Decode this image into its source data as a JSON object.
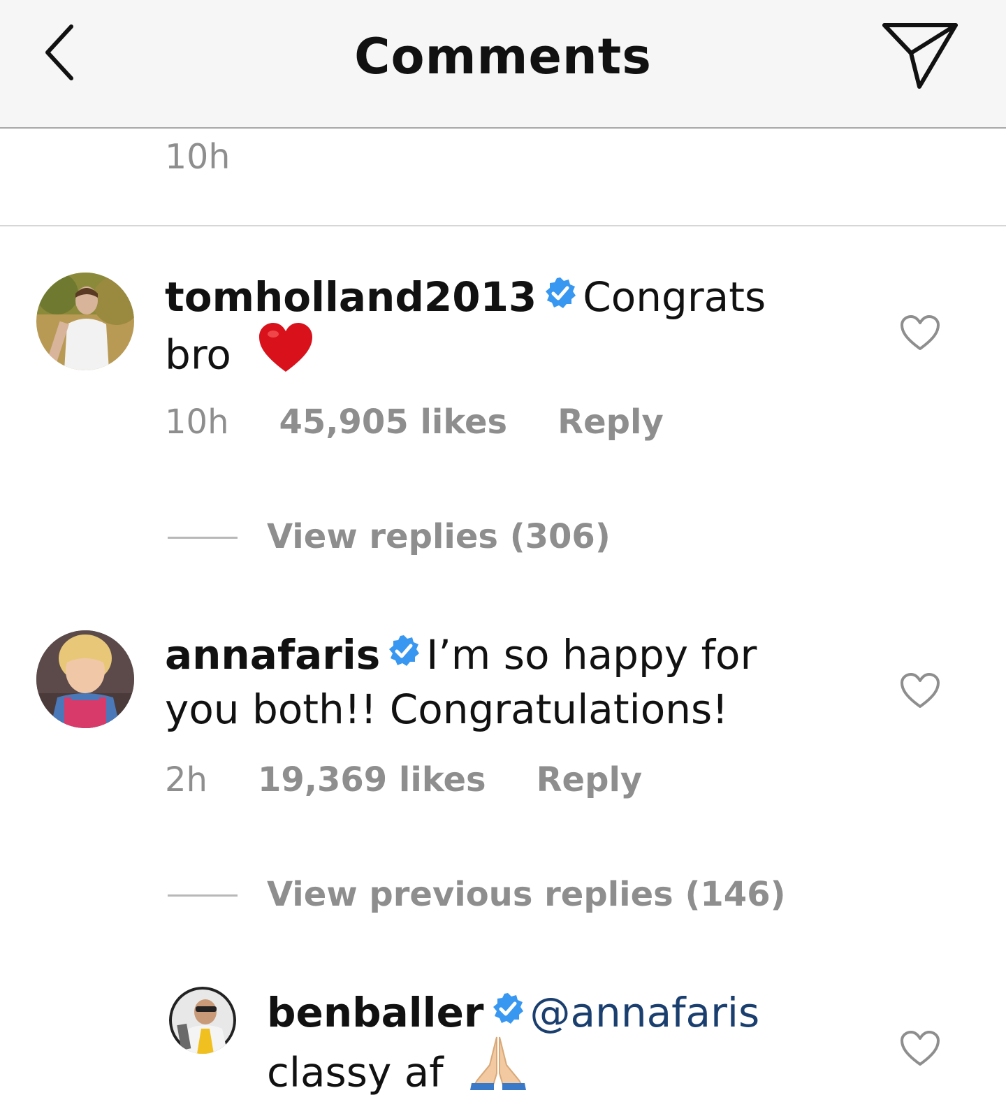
{
  "header": {
    "title": "Comments",
    "back_icon": "chevron-left-icon",
    "send_icon": "paper-plane-icon"
  },
  "top_fragment": {
    "time": "10h"
  },
  "comments": [
    {
      "username": "tomholland2013",
      "verified": true,
      "text_line1": "Congrats",
      "text_line2": "bro",
      "emoji": "red-heart",
      "time": "10h",
      "likes": "45,905 likes",
      "reply_label": "Reply",
      "view_replies": "View replies (306)"
    },
    {
      "username": "annafaris",
      "verified": true,
      "text_line1": "I’m so happy for",
      "text_line2": "you both!! Congratulations!",
      "time": "2h",
      "likes": "19,369 likes",
      "reply_label": "Reply",
      "view_replies": "View previous replies (146)"
    },
    {
      "username": "benballer",
      "verified": true,
      "mention": "@annafaris",
      "text_line2": "classy af",
      "emoji": "folded-hands"
    }
  ],
  "colors": {
    "verified_blue": "#3897f0",
    "secondary_gray": "#8e8e8e",
    "text": "#111111",
    "header_bg": "#f6f6f6"
  }
}
